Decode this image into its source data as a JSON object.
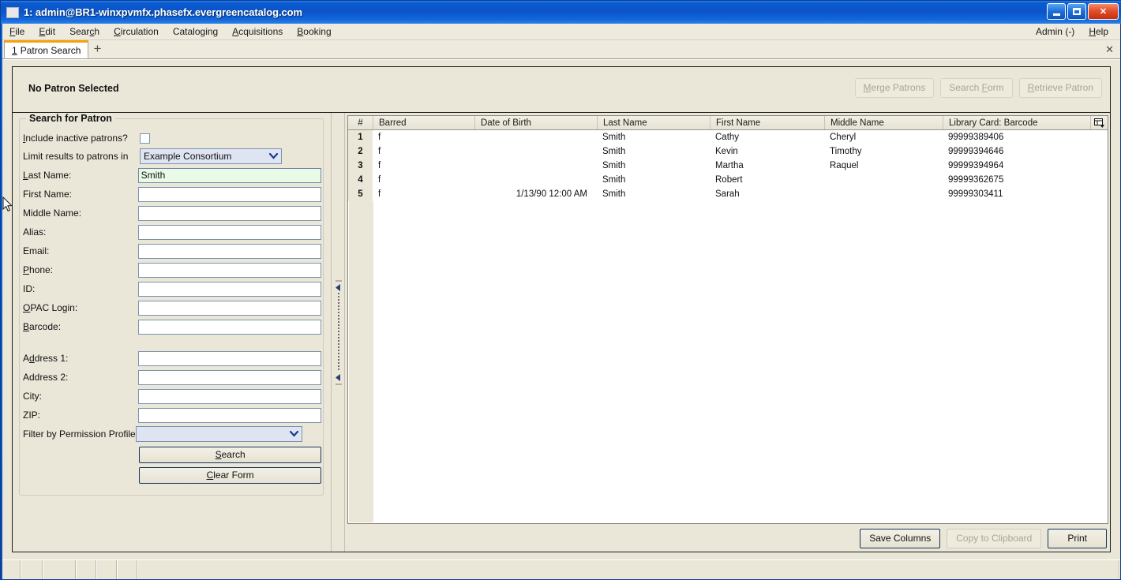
{
  "window": {
    "title": "1: admin@BR1-winxpvmfx.phasefx.evergreencatalog.com",
    "minimize_label": "Minimize",
    "maximize_label": "Maximize",
    "close_label": "✕"
  },
  "menubar": {
    "items": [
      {
        "label": "File",
        "accel": "F"
      },
      {
        "label": "Edit",
        "accel": "E"
      },
      {
        "label": "Search",
        "accel": "c"
      },
      {
        "label": "Circulation",
        "accel": "C"
      },
      {
        "label": "Cataloging",
        "accel": "g"
      },
      {
        "label": "Acquisitions",
        "accel": "A"
      },
      {
        "label": "Booking",
        "accel": "B"
      }
    ],
    "right": [
      {
        "label": "Admin (-)"
      },
      {
        "label": "Help",
        "accel": "H"
      }
    ]
  },
  "tabs": {
    "active": {
      "index": "1",
      "label": "Patron Search"
    },
    "new_tab_label": "+",
    "close_label": "✕"
  },
  "patron_bar": {
    "status": "No Patron Selected",
    "buttons": [
      {
        "label": "Merge Patrons",
        "name": "merge-patrons-button",
        "disabled": true
      },
      {
        "label": "Search Form",
        "name": "search-form-button",
        "disabled": true
      },
      {
        "label": "Retrieve Patron",
        "name": "retrieve-patron-button",
        "disabled": true
      }
    ]
  },
  "search_form": {
    "legend": "Search for Patron",
    "include_inactive_label": "Include inactive patrons?",
    "include_inactive_checked": false,
    "limit_label": "Limit results to patrons in",
    "limit_value": "Example Consortium",
    "fields": [
      {
        "label": "Last Name:",
        "value": "Smith",
        "name": "last-name-input",
        "active": true
      },
      {
        "label": "First Name:",
        "value": "",
        "name": "first-name-input",
        "active": false
      },
      {
        "label": "Middle Name:",
        "value": "",
        "name": "middle-name-input",
        "active": false
      },
      {
        "label": "Alias:",
        "value": "",
        "name": "alias-input",
        "active": false
      },
      {
        "label": "Email:",
        "value": "",
        "name": "email-input",
        "active": false
      },
      {
        "label": "Phone:",
        "value": "",
        "name": "phone-input",
        "active": false
      },
      {
        "label": "ID:",
        "value": "",
        "name": "id-input",
        "active": false
      },
      {
        "label": "OPAC Login:",
        "value": "",
        "name": "opac-login-input",
        "active": false
      },
      {
        "label": "Barcode:",
        "value": "",
        "name": "barcode-input",
        "active": false
      }
    ],
    "address_fields": [
      {
        "label": "Address 1:",
        "value": "",
        "name": "address1-input"
      },
      {
        "label": "Address 2:",
        "value": "",
        "name": "address2-input"
      },
      {
        "label": "City:",
        "value": "",
        "name": "city-input"
      },
      {
        "label": "ZIP:",
        "value": "",
        "name": "zip-input"
      }
    ],
    "permission_label": "Filter by Permission Profile:",
    "permission_value": "",
    "search_button": "Search",
    "clear_button": "Clear Form"
  },
  "results": {
    "columns": [
      "#",
      "Barred",
      "Date of Birth",
      "Last Name",
      "First Name",
      "Middle Name",
      "Library Card: Barcode"
    ],
    "rows": [
      {
        "num": "1",
        "barred": "f",
        "dob": "",
        "last": "Smith",
        "first": "Cathy",
        "middle": "Cheryl",
        "barcode": "99999389406"
      },
      {
        "num": "2",
        "barred": "f",
        "dob": "",
        "last": "Smith",
        "first": "Kevin",
        "middle": "Timothy",
        "barcode": "99999394646"
      },
      {
        "num": "3",
        "barred": "f",
        "dob": "",
        "last": "Smith",
        "first": "Martha",
        "middle": "Raquel",
        "barcode": "99999394964"
      },
      {
        "num": "4",
        "barred": "f",
        "dob": "",
        "last": "Smith",
        "first": "Robert",
        "middle": "",
        "barcode": "99999362675"
      },
      {
        "num": "5",
        "barred": "f",
        "dob": "1/13/90 12:00 AM",
        "last": "Smith",
        "first": "Sarah",
        "middle": "",
        "barcode": "99999303411"
      }
    ],
    "buttons": [
      {
        "label": "Save Columns",
        "name": "save-columns-button",
        "disabled": false
      },
      {
        "label": "Copy to Clipboard",
        "name": "copy-to-clipboard-button",
        "disabled": true
      },
      {
        "label": "Print",
        "name": "print-button",
        "disabled": false
      }
    ]
  },
  "colors": {
    "titlebar_blue": "#0a54c8",
    "chrome_beige": "#eae7d8",
    "tab_accent": "#f3a306",
    "active_field_green": "#e9fae6",
    "dropdown_blue": "#dfe4f2"
  }
}
